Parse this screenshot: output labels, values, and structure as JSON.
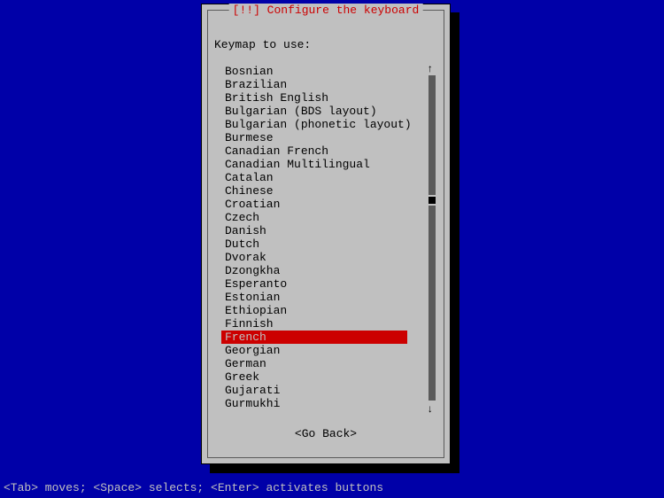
{
  "dialog": {
    "title": "[!!] Configure the keyboard",
    "prompt": "Keymap to use:",
    "go_back": "<Go Back>",
    "selected_index": 20,
    "items": [
      "Bosnian",
      "Brazilian",
      "British English",
      "Bulgarian (BDS layout)",
      "Bulgarian (phonetic layout)",
      "Burmese",
      "Canadian French",
      "Canadian Multilingual",
      "Catalan",
      "Chinese",
      "Croatian",
      "Czech",
      "Danish",
      "Dutch",
      "Dvorak",
      "Dzongkha",
      "Esperanto",
      "Estonian",
      "Ethiopian",
      "Finnish",
      "French",
      "Georgian",
      "German",
      "Greek",
      "Gujarati",
      "Gurmukhi"
    ]
  },
  "status_bar": "<Tab> moves; <Space> selects; <Enter> activates buttons"
}
